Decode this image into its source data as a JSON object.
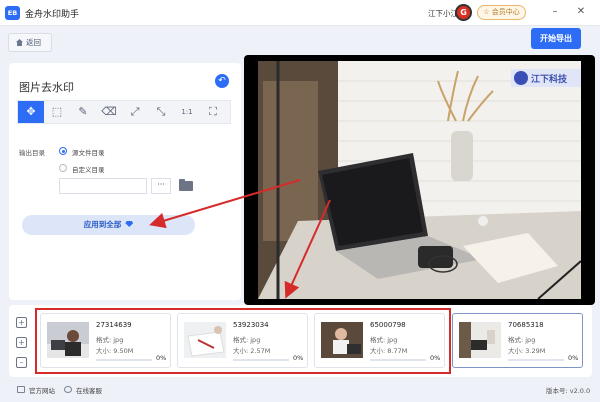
{
  "app": {
    "logo": "EB",
    "title": "金舟水印助手"
  },
  "titlebar": {
    "user_name": "江下小江",
    "avatar_text": "G",
    "vip_label": "☆ 会员中心",
    "minimize": "–",
    "close": "✕"
  },
  "header": {
    "back_label": "返回",
    "export_label": "开始导出"
  },
  "panel": {
    "title": "图片去水印",
    "undo": "↶",
    "tools": [
      {
        "icon": "move-icon",
        "glyph": "✥"
      },
      {
        "icon": "rect-select-icon",
        "glyph": "⬚"
      },
      {
        "icon": "pen-icon",
        "glyph": "✎"
      },
      {
        "icon": "eraser-icon",
        "glyph": "⌫"
      },
      {
        "icon": "expand-icon",
        "glyph": "⤢"
      },
      {
        "icon": "shrink-icon",
        "glyph": "⤡"
      },
      {
        "icon": "ratio-icon",
        "glyph": "1:1"
      },
      {
        "icon": "fit-icon",
        "glyph": "⛶"
      }
    ],
    "output_label": "输出目录",
    "option_source": "源文件目录",
    "option_custom": "自定义目录",
    "path_value": "",
    "browse_label": "···",
    "apply_label": "应用到全部"
  },
  "watermark": {
    "text": "江下科技"
  },
  "files": [
    {
      "name": "27314639",
      "format": "格式: jpg",
      "size": "大小: 9.50M",
      "progress": 0,
      "progress_label": "0%"
    },
    {
      "name": "53923034",
      "format": "格式: jpg",
      "size": "大小: 2.57M",
      "progress": 0,
      "progress_label": "0%"
    },
    {
      "name": "65000798",
      "format": "格式: jpg",
      "size": "大小: 8.77M",
      "progress": 0,
      "progress_label": "0%"
    },
    {
      "name": "70685318",
      "format": "格式: jpg",
      "size": "大小: 3.29M",
      "progress": 0,
      "progress_label": "0%"
    }
  ],
  "footer": {
    "website": "官方网站",
    "support": "在线客服",
    "version": "版本号: v2.0.0"
  },
  "colors": {
    "accent": "#2d6df6",
    "highlight_red": "#d62b2b"
  }
}
